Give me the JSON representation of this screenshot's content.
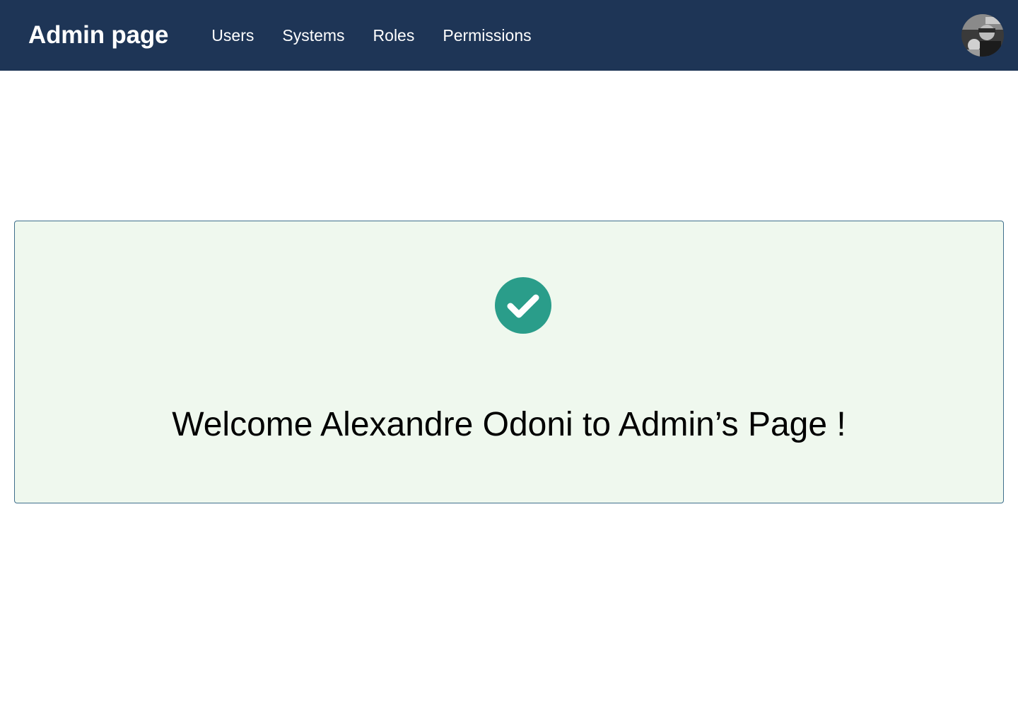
{
  "navbar": {
    "brand": "Admin page",
    "background": "#1e3556",
    "links": [
      {
        "label": "Users"
      },
      {
        "label": "Systems"
      },
      {
        "label": "Roles"
      },
      {
        "label": "Permissions"
      }
    ],
    "avatar_icon": "user-avatar"
  },
  "panel": {
    "background": "#eff8ee",
    "border_color": "#3f6f8c",
    "icon": "check-circle-icon",
    "icon_color": "#2a9d8a",
    "message": "Welcome Alexandre Odoni to Admin’s Page !"
  }
}
